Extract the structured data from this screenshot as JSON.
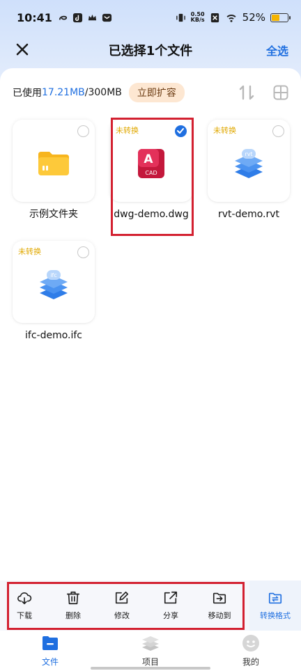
{
  "status_bar": {
    "time": "10:41",
    "net_speed_value": "0.50",
    "net_speed_unit": "KB/s",
    "battery": "52%",
    "battery_level": 0.52
  },
  "header": {
    "title": "已选择1个文件",
    "select_all": "全选"
  },
  "storage": {
    "prefix": "已使用",
    "used": "17.21MB",
    "total": "/300MB",
    "expand_label": "立即扩容"
  },
  "files": [
    {
      "name": "示例文件夹",
      "tag": "",
      "type": "folder",
      "selected": false
    },
    {
      "name": "dwg-demo.dwg",
      "tag": "未转换",
      "type": "cad",
      "selected": true,
      "icon_text": "A",
      "icon_sub": "CAD"
    },
    {
      "name": "rvt-demo.rvt",
      "tag": "未转换",
      "type": "rvt",
      "selected": false,
      "icon_text": "rvt"
    },
    {
      "name": "ifc-demo.ifc",
      "tag": "未转换",
      "type": "ifc",
      "selected": false,
      "icon_text": "ifc"
    }
  ],
  "actions": {
    "download": "下载",
    "delete": "删除",
    "edit": "修改",
    "share": "分享",
    "move": "移动到",
    "convert": "转换格式"
  },
  "nav": {
    "files": "文件",
    "projects": "项目",
    "mine": "我的"
  },
  "colors": {
    "accent": "#1f6fe0",
    "tag": "#e0a800",
    "highlight": "#d32030"
  }
}
